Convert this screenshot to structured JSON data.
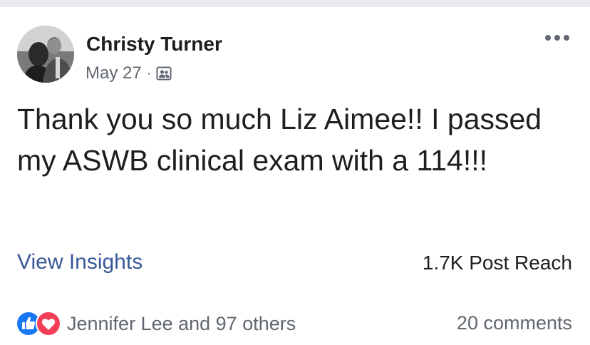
{
  "post": {
    "author": "Christy Turner",
    "date": "May 27",
    "separator": "·",
    "audience_icon": "friends-list-icon",
    "more_icon": "more-options-icon",
    "text": "Thank you so much Liz Aimee!! I passed my ASWB clinical exam with a 114!!!"
  },
  "insights": {
    "link_label": "View Insights",
    "reach": "1.7K Post Reach"
  },
  "engagement": {
    "reaction_icons": [
      "like-icon",
      "love-icon"
    ],
    "reactions_text": "Jennifer Lee and 97 others",
    "comments_text": "20 comments"
  },
  "colors": {
    "link_blue": "#385898",
    "like_blue": "#1877f2",
    "love_red": "#f33e58",
    "secondary_text": "#606770",
    "primary_text": "#1c1e21",
    "divider": "#e9ebee"
  }
}
